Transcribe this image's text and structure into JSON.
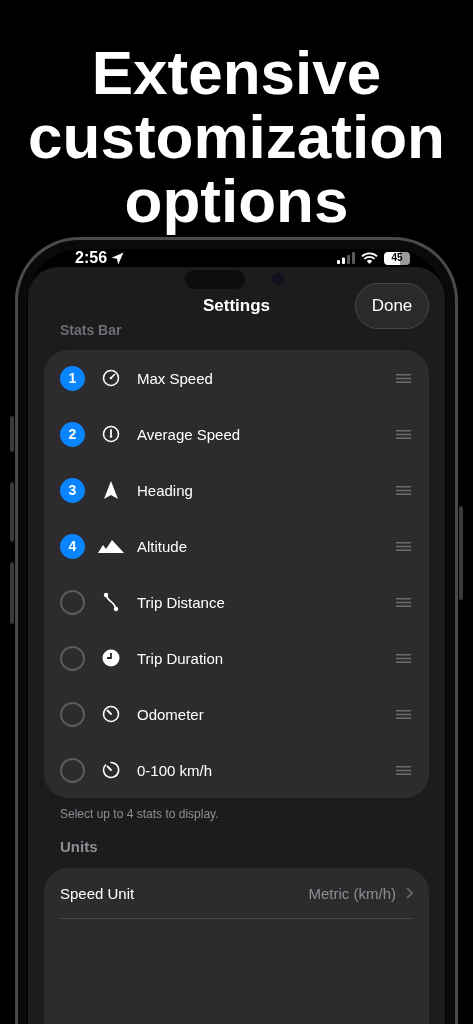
{
  "headline": "Extensive customization options",
  "status_bar": {
    "time": "2:56",
    "battery": "45"
  },
  "sheet": {
    "title": "Settings",
    "done_button": "Done"
  },
  "stats_bar": {
    "header": "Stats Bar",
    "items": [
      {
        "order": "1",
        "label": "Max Speed",
        "selected": true
      },
      {
        "order": "2",
        "label": "Average Speed",
        "selected": true
      },
      {
        "order": "3",
        "label": "Heading",
        "selected": true
      },
      {
        "order": "4",
        "label": "Altitude",
        "selected": true
      },
      {
        "label": "Trip Distance",
        "selected": false
      },
      {
        "label": "Trip Duration",
        "selected": false
      },
      {
        "label": "Odometer",
        "selected": false
      },
      {
        "label": "0-100 km/h",
        "selected": false
      }
    ],
    "footer": "Select up to 4 stats to display."
  },
  "units": {
    "header": "Units",
    "rows": [
      {
        "label": "Speed Unit",
        "value": "Metric (km/h)"
      }
    ]
  }
}
